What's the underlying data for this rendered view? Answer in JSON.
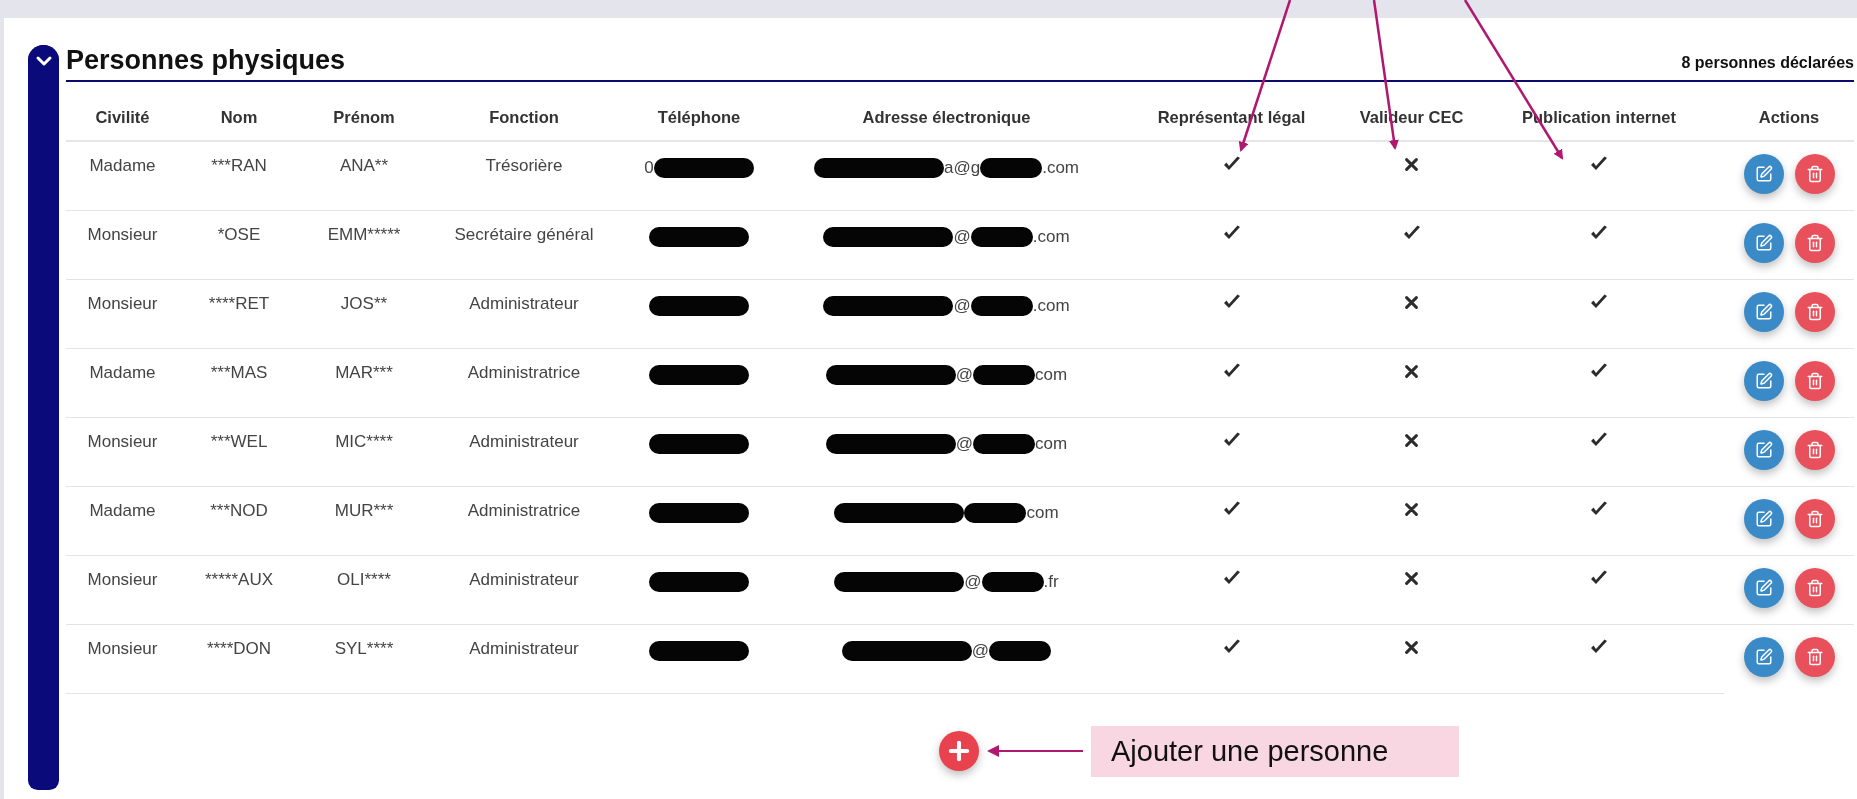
{
  "section": {
    "title": "Personnes physiques",
    "expanded": true,
    "count": "8 personnes déclarées"
  },
  "table": {
    "columns": [
      "Civilité",
      "Nom",
      "Prénom",
      "Fonction",
      "Téléphone",
      "Adresse électronique",
      "Représentant légal",
      "Valideur CEC",
      "Publication internet",
      "Actions"
    ],
    "rows": [
      {
        "civilite": "Madame",
        "nom": "***RAN",
        "prenom": "ANA**",
        "fonction": "Trésorière",
        "phone": [
          {
            "kind": "text",
            "text": "0"
          },
          {
            "kind": "redaction"
          }
        ],
        "email": [
          {
            "kind": "redaction"
          },
          {
            "kind": "text",
            "text": "a@g"
          },
          {
            "kind": "redaction"
          },
          {
            "kind": "text",
            "text": ".com"
          }
        ],
        "representant": true,
        "valideur": false,
        "publication": true
      },
      {
        "civilite": "Monsieur",
        "nom": "*OSE",
        "prenom": "EMM*****",
        "fonction": "Secrétaire général",
        "phone": [
          {
            "kind": "redaction"
          }
        ],
        "email": [
          {
            "kind": "redaction"
          },
          {
            "kind": "text",
            "text": "@"
          },
          {
            "kind": "redaction"
          },
          {
            "kind": "text",
            "text": ".com"
          }
        ],
        "representant": true,
        "valideur": true,
        "publication": true
      },
      {
        "civilite": "Monsieur",
        "nom": "****RET",
        "prenom": "JOS**",
        "fonction": "Administrateur",
        "phone": [
          {
            "kind": "redaction"
          }
        ],
        "email": [
          {
            "kind": "redaction"
          },
          {
            "kind": "text",
            "text": "@"
          },
          {
            "kind": "redaction"
          },
          {
            "kind": "text",
            "text": ".com"
          }
        ],
        "representant": true,
        "valideur": false,
        "publication": true
      },
      {
        "civilite": "Madame",
        "nom": "***MAS",
        "prenom": "MAR***",
        "fonction": "Administratrice",
        "phone": [
          {
            "kind": "redaction"
          }
        ],
        "email": [
          {
            "kind": "redaction"
          },
          {
            "kind": "text",
            "text": "@"
          },
          {
            "kind": "redaction"
          },
          {
            "kind": "text",
            "text": "com"
          }
        ],
        "representant": true,
        "valideur": false,
        "publication": true
      },
      {
        "civilite": "Monsieur",
        "nom": "***WEL",
        "prenom": "MIC****",
        "fonction": "Administrateur",
        "phone": [
          {
            "kind": "redaction"
          }
        ],
        "email": [
          {
            "kind": "redaction"
          },
          {
            "kind": "text",
            "text": "@"
          },
          {
            "kind": "redaction"
          },
          {
            "kind": "text",
            "text": "com"
          }
        ],
        "representant": true,
        "valideur": false,
        "publication": true
      },
      {
        "civilite": "Madame",
        "nom": "***NOD",
        "prenom": "MUR***",
        "fonction": "Administratrice",
        "phone": [
          {
            "kind": "redaction"
          }
        ],
        "email": [
          {
            "kind": "redaction"
          },
          {
            "kind": "redaction"
          },
          {
            "kind": "text",
            "text": "com"
          }
        ],
        "representant": true,
        "valideur": false,
        "publication": true
      },
      {
        "civilite": "Monsieur",
        "nom": "*****AUX",
        "prenom": "OLI****",
        "fonction": "Administrateur",
        "phone": [
          {
            "kind": "redaction"
          }
        ],
        "email": [
          {
            "kind": "redaction"
          },
          {
            "kind": "text",
            "text": "@"
          },
          {
            "kind": "redaction"
          },
          {
            "kind": "text",
            "text": ".fr"
          }
        ],
        "representant": true,
        "valideur": false,
        "publication": true
      },
      {
        "civilite": "Monsieur",
        "nom": "****DON",
        "prenom": "SYL****",
        "fonction": "Administrateur",
        "phone": [
          {
            "kind": "redaction"
          }
        ],
        "email": [
          {
            "kind": "redaction"
          },
          {
            "kind": "text",
            "text": "@"
          },
          {
            "kind": "redaction"
          }
        ],
        "representant": true,
        "valideur": false,
        "publication": true
      }
    ]
  },
  "annotation": {
    "text": "Ajouter une personne"
  }
}
